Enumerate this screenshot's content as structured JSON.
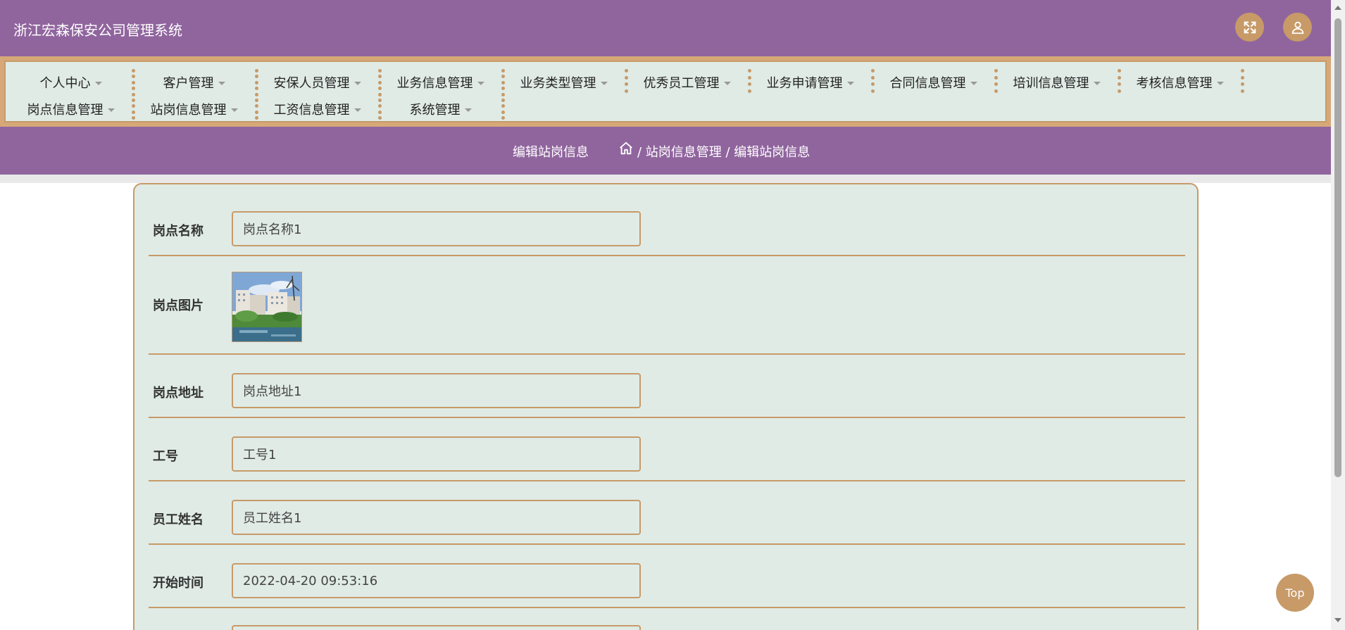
{
  "header": {
    "title": "浙江宏森保安公司管理系统",
    "fullscreen_icon": "expand-icon",
    "user_icon": "user-icon"
  },
  "nav": {
    "row1": [
      "个人中心",
      "客户管理",
      "安保人员管理",
      "业务信息管理",
      "业务类型管理",
      "优秀员工管理",
      "业务申请管理",
      "合同信息管理",
      "培训信息管理",
      "考核信息管理"
    ],
    "row2": [
      "岗点信息管理",
      "站岗信息管理",
      "工资信息管理",
      "系统管理"
    ]
  },
  "breadcrumb": {
    "page_title": "编辑站岗信息",
    "home_icon": "home-icon",
    "path": "/ 站岗信息管理 / 编辑站岗信息"
  },
  "form": {
    "fields": [
      {
        "label": "岗点名称",
        "value": "岗点名称1"
      },
      {
        "label": "岗点图片",
        "image": "building-photo"
      },
      {
        "label": "岗点地址",
        "value": "岗点地址1"
      },
      {
        "label": "工号",
        "value": "工号1"
      },
      {
        "label": "员工姓名",
        "value": "员工姓名1"
      },
      {
        "label": "开始时间",
        "value": "2022-04-20 09:53:16"
      }
    ]
  },
  "top_button": {
    "label": "Top"
  },
  "colors": {
    "header": "#90659e",
    "accent": "#c79a68",
    "panel": "#e0ebe6"
  }
}
